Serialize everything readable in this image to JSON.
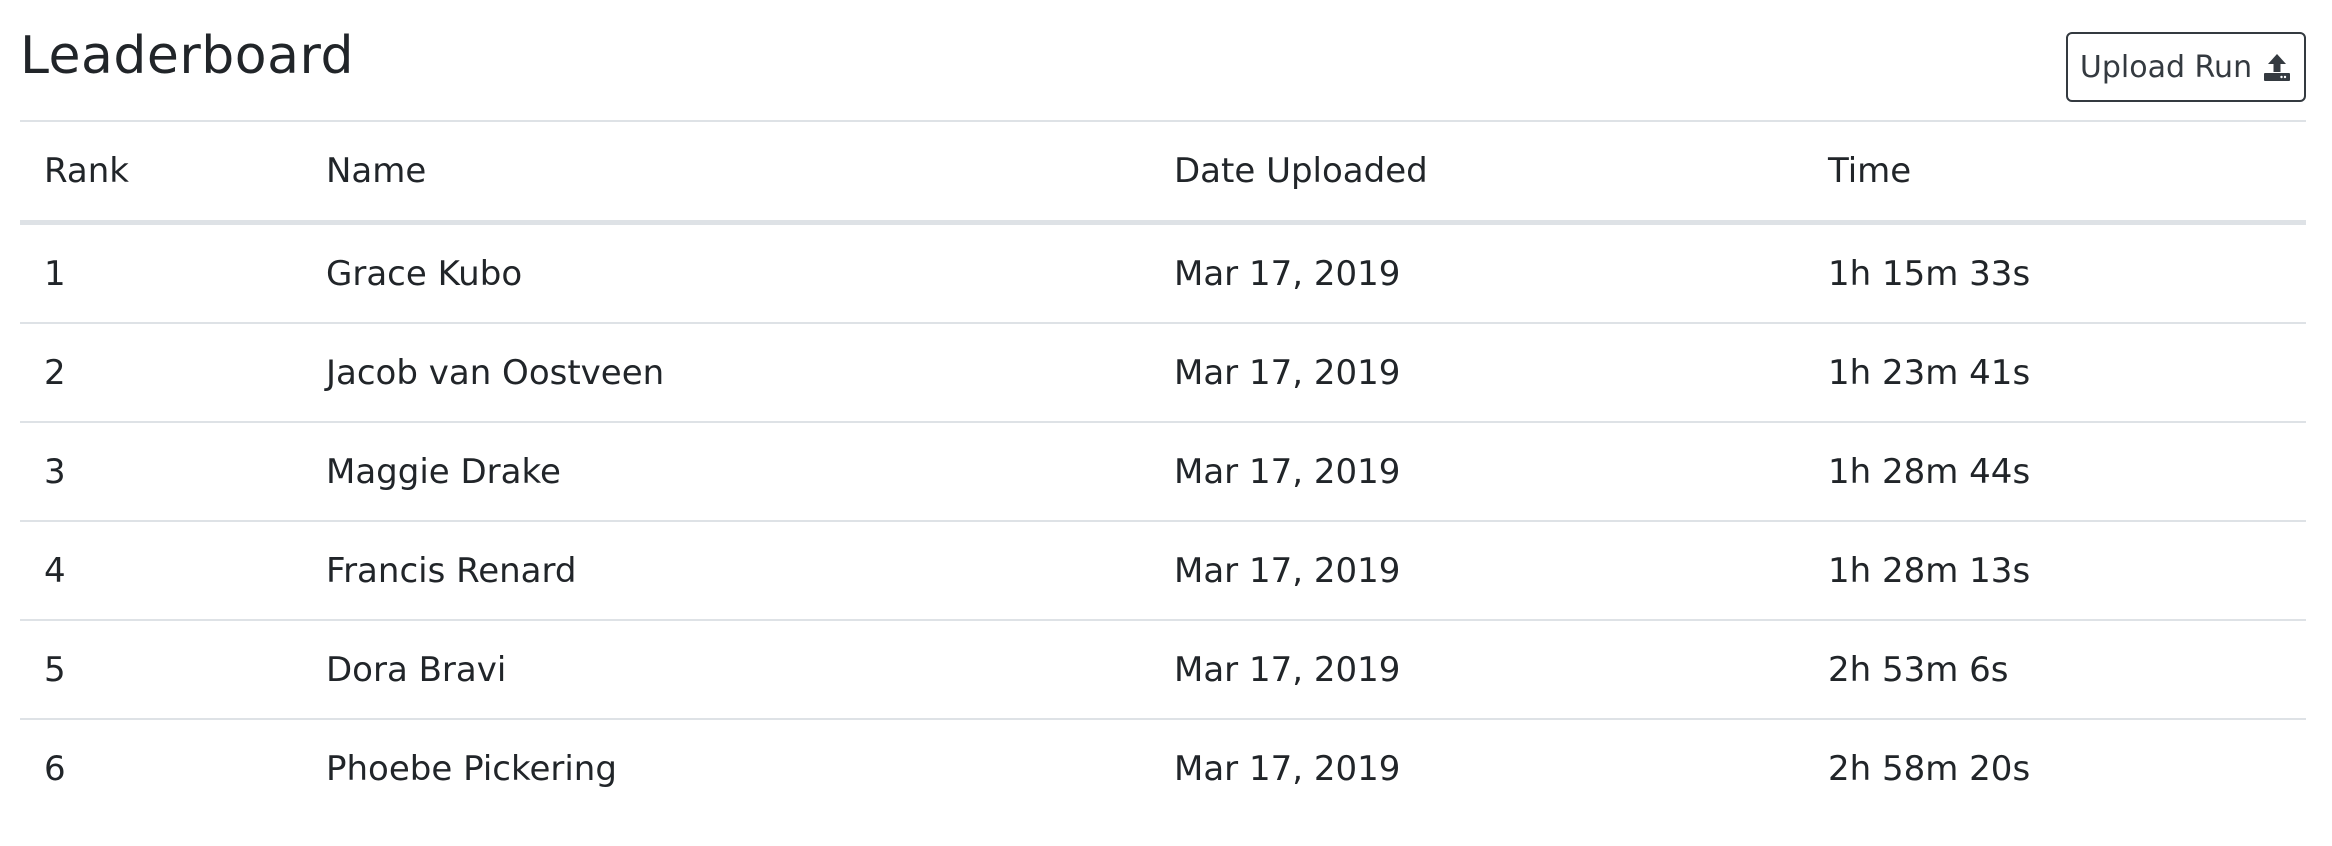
{
  "page": {
    "title": "Leaderboard"
  },
  "toolbar": {
    "upload_label": "Upload Run",
    "upload_icon": "upload-icon"
  },
  "table": {
    "headers": {
      "rank": "Rank",
      "name": "Name",
      "date": "Date Uploaded",
      "time": "Time"
    },
    "rows": [
      {
        "rank": "1",
        "name": "Grace Kubo",
        "date": "Mar 17, 2019",
        "time": "1h 15m 33s"
      },
      {
        "rank": "2",
        "name": "Jacob van Oostveen",
        "date": "Mar 17, 2019",
        "time": "1h 23m 41s"
      },
      {
        "rank": "3",
        "name": "Maggie Drake",
        "date": "Mar 17, 2019",
        "time": "1h 28m 44s"
      },
      {
        "rank": "4",
        "name": "Francis Renard",
        "date": "Mar 17, 2019",
        "time": "1h 28m 13s"
      },
      {
        "rank": "5",
        "name": "Dora Bravi",
        "date": "Mar 17, 2019",
        "time": "2h 53m 6s"
      },
      {
        "rank": "6",
        "name": "Phoebe Pickering",
        "date": "Mar 17, 2019",
        "time": "2h 58m 20s"
      }
    ]
  },
  "colors": {
    "text": "#212529",
    "border": "#dee2e6",
    "button_border": "#343a40"
  }
}
